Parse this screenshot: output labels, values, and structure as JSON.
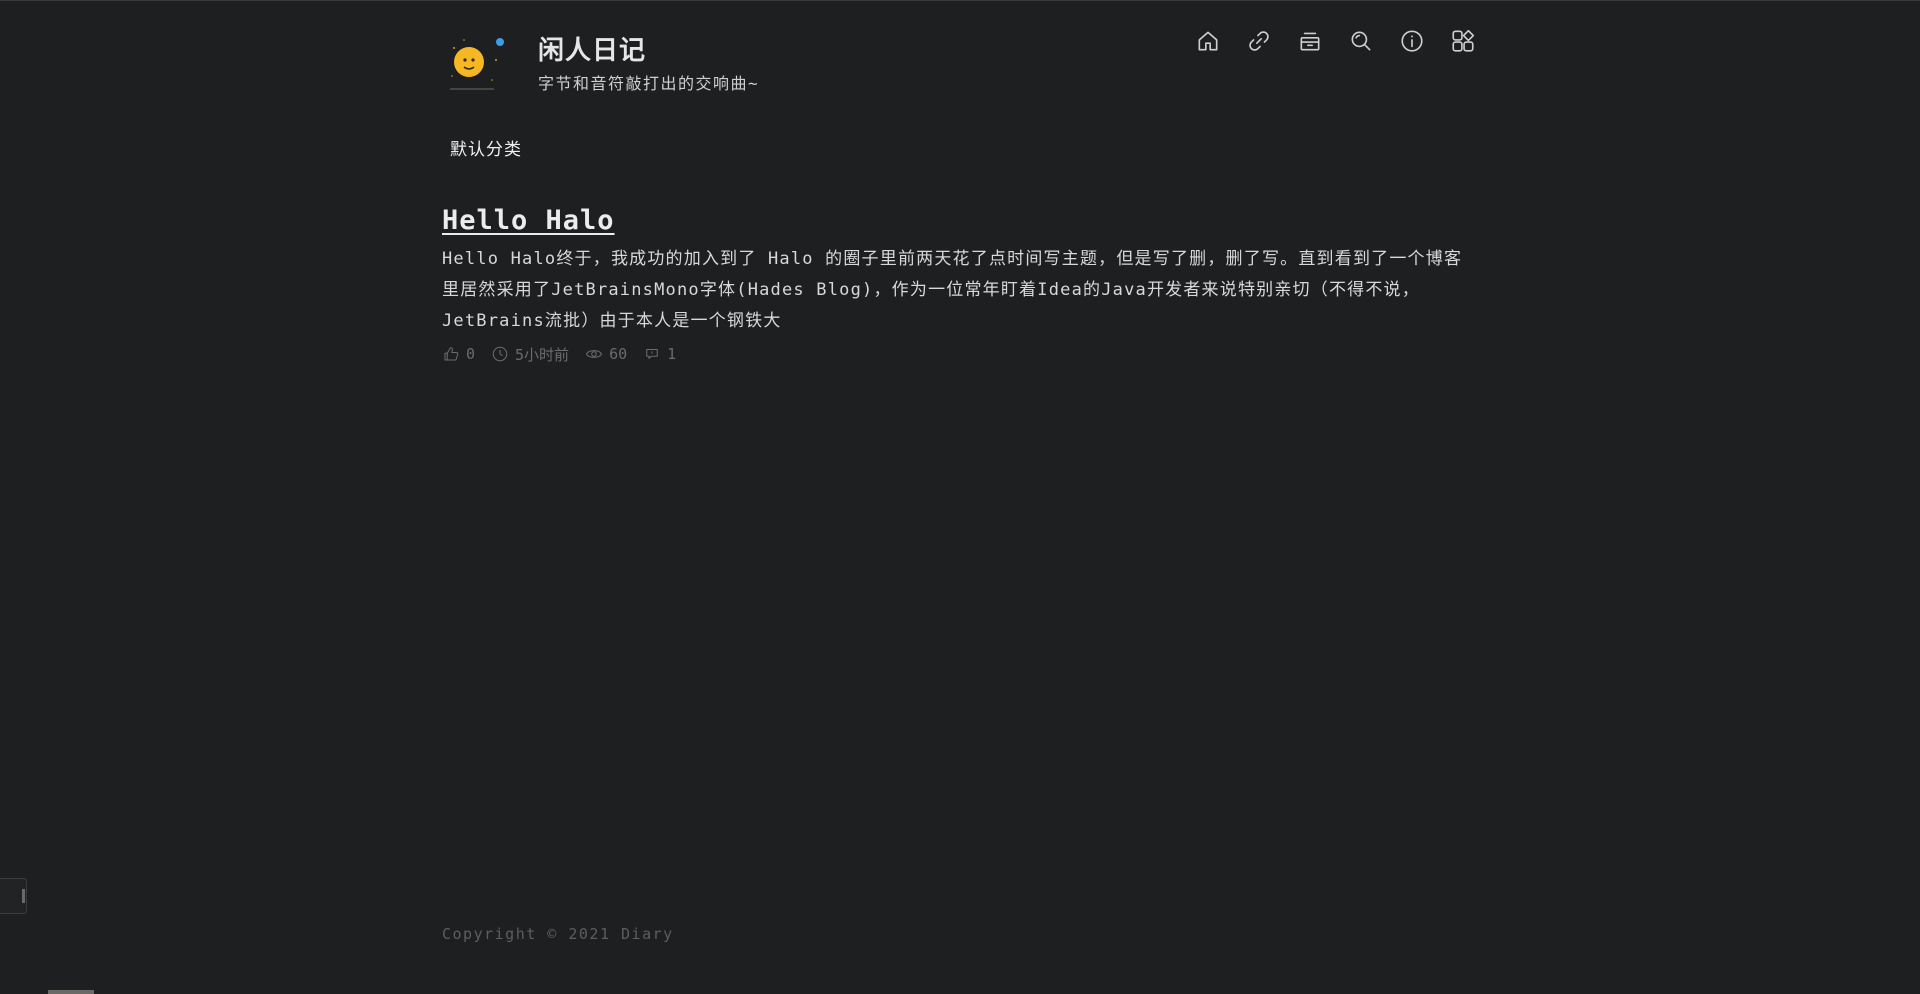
{
  "site": {
    "title": "闲人日记",
    "subtitle": "字节和音符敲打出的交响曲~"
  },
  "nav": {
    "items": [
      {
        "name": "home",
        "icon": "home-icon"
      },
      {
        "name": "links",
        "icon": "link-icon"
      },
      {
        "name": "archive",
        "icon": "archive-icon"
      },
      {
        "name": "search",
        "icon": "search-icon"
      },
      {
        "name": "about",
        "icon": "info-icon"
      },
      {
        "name": "categories",
        "icon": "apps-icon"
      }
    ]
  },
  "category": {
    "label": "默认分类"
  },
  "post": {
    "title": "Hello Halo",
    "excerpt": "Hello Halo终于，我成功的加入到了 Halo 的圈子里前两天花了点时间写主题，但是写了删，删了写。直到看到了一个博客里居然采用了JetBrainsMono字体(Hades Blog)，作为一位常年盯着Idea的Java开发者来说特别亲切（不得不说，JetBrains流批）由于本人是一个钢铁大",
    "meta": {
      "likes": "0",
      "time": "5小时前",
      "views": "60",
      "comments": "1"
    }
  },
  "footer": {
    "copyright": "Copyright © 2021 Diary"
  },
  "colors": {
    "background": "#1e1f21",
    "text": "#d6d6d6",
    "muted": "#6c6c6c"
  }
}
